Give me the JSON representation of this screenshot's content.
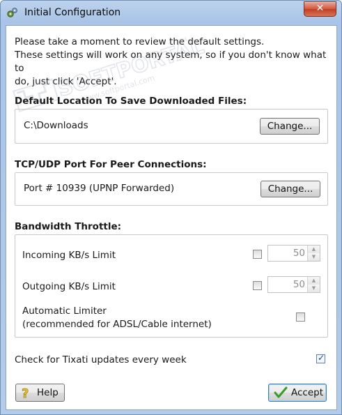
{
  "window": {
    "title": "Initial Configuration",
    "close_glyph": "✕"
  },
  "intro": {
    "line1": "Please take a moment to review the default settings.",
    "line2": "These settings will work on any system, so if you don't know what to",
    "line3": "do, just click 'Accept'."
  },
  "download_location": {
    "title": "Default Location To Save Downloaded Files:",
    "path": "C:\\Downloads",
    "change_label": "Change..."
  },
  "peer_port": {
    "title": "TCP/UDP Port For Peer Connections:",
    "value": "Port # 10939 (UPNP Forwarded)",
    "change_label": "Change..."
  },
  "bandwidth": {
    "title": "Bandwidth Throttle:",
    "incoming_label": "Incoming KB/s Limit",
    "incoming_checked": false,
    "incoming_value": "50",
    "outgoing_label": "Outgoing KB/s Limit",
    "outgoing_checked": false,
    "outgoing_value": "50",
    "auto_line1": "Automatic Limiter",
    "auto_line2": "(recommended for ADSL/Cable internet)",
    "auto_checked": false
  },
  "updates": {
    "label": "Check for Tixati updates every week",
    "checked": true
  },
  "buttons": {
    "help_label": "Help",
    "accept_label": "Accept"
  },
  "watermark": {
    "brand": "SOFTPORTAL",
    "url": "www.softportal.com",
    "tm": "TM"
  },
  "colors": {
    "accept_border": "#3c7fb1",
    "title_bar": "#b4cbe9"
  }
}
